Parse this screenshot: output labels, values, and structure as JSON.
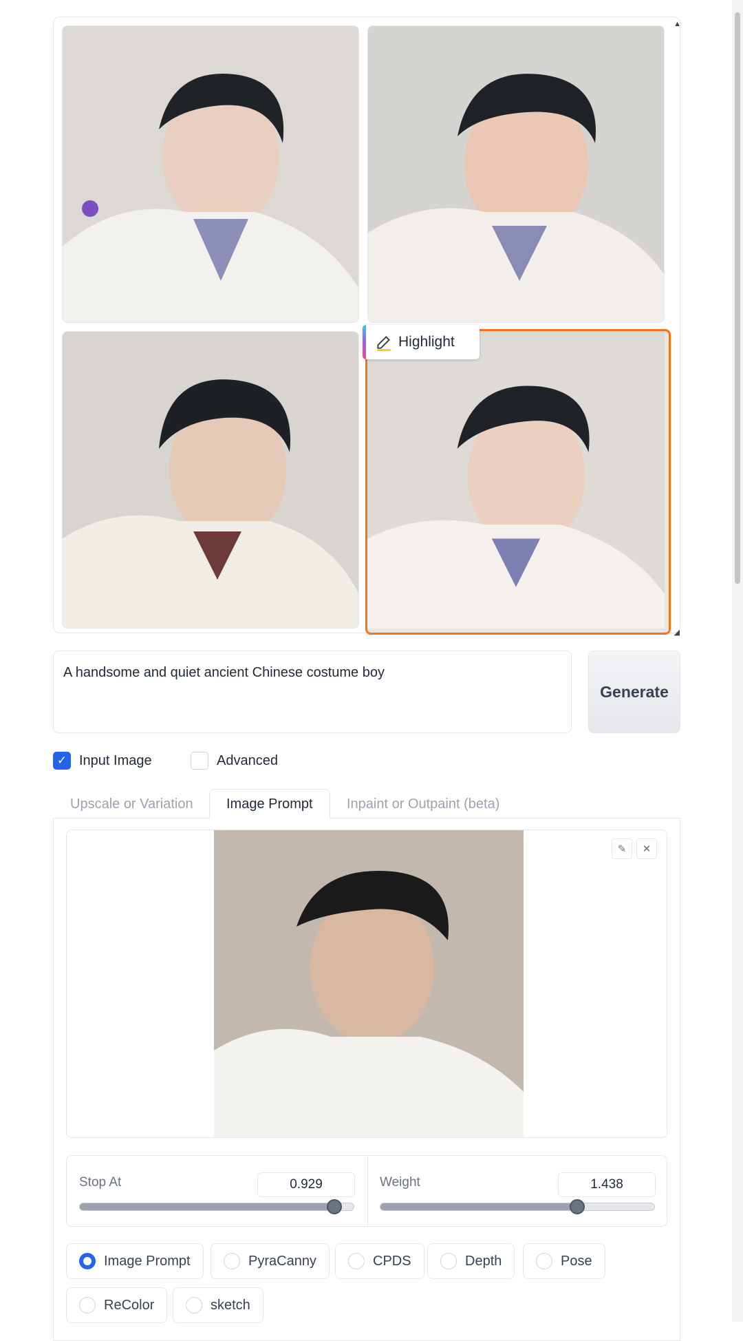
{
  "gallery": {
    "highlight_label": "Highlight",
    "images": [
      {
        "alt": "generated-image-1",
        "selected": false
      },
      {
        "alt": "generated-image-2",
        "selected": false
      },
      {
        "alt": "generated-image-3",
        "selected": false
      },
      {
        "alt": "generated-image-4",
        "selected": true
      }
    ]
  },
  "prompt": {
    "value": "A handsome and quiet ancient Chinese costume boy"
  },
  "generate_label": "Generate",
  "options": {
    "input_image": {
      "label": "Input Image",
      "checked": true
    },
    "advanced": {
      "label": "Advanced",
      "checked": false
    }
  },
  "tabs": [
    {
      "label": "Upscale or Variation",
      "active": false
    },
    {
      "label": "Image Prompt",
      "active": true
    },
    {
      "label": "Inpaint or Outpaint (beta)",
      "active": false
    }
  ],
  "sliders": {
    "stop_at": {
      "label": "Stop At",
      "value": "0.929",
      "fraction": 0.929
    },
    "weight": {
      "label": "Weight",
      "value": "1.438",
      "fraction": 0.719
    }
  },
  "radios": [
    {
      "label": "Image Prompt",
      "checked": true
    },
    {
      "label": "PyraCanny",
      "checked": false
    },
    {
      "label": "CPDS",
      "checked": false
    },
    {
      "label": "Depth",
      "checked": false
    },
    {
      "label": "Pose",
      "checked": false
    },
    {
      "label": "ReColor",
      "checked": false
    },
    {
      "label": "sketch",
      "checked": false
    }
  ],
  "icons": {
    "edit": "pencil-icon",
    "clear": "close-icon"
  }
}
